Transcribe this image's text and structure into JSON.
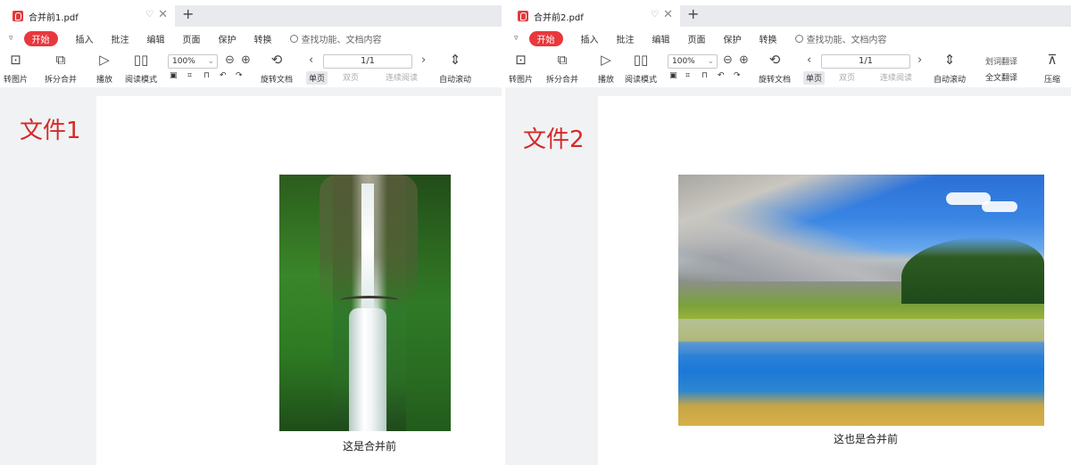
{
  "left_window": {
    "tab_title": "合并前1.pdf",
    "menu": [
      "开始",
      "插入",
      "批注",
      "编辑",
      "页面",
      "保护",
      "转换"
    ],
    "search_placeholder": "查找功能、文档内容",
    "toolbar": {
      "to_image": "转图片",
      "split_merge": "拆分合并",
      "play": "播放",
      "read_mode": "阅读模式",
      "zoom": "100%",
      "rotate_doc": "旋转文档",
      "page_indicator": "1/1",
      "single_page": "单页",
      "double_page": "双页",
      "continuous": "连续阅读",
      "auto_scroll": "自动滚动"
    },
    "side_label": "文件1",
    "caption": "这是合并前"
  },
  "right_window": {
    "tab_title": "合并前2.pdf",
    "menu": [
      "开始",
      "插入",
      "批注",
      "编辑",
      "页面",
      "保护",
      "转换"
    ],
    "search_placeholder": "查找功能、文档内容",
    "toolbar": {
      "to_image": "转图片",
      "split_merge": "拆分合并",
      "play": "播放",
      "read_mode": "阅读模式",
      "zoom": "100%",
      "rotate_doc": "旋转文档",
      "page_indicator": "1/1",
      "single_page": "单页",
      "double_page": "双页",
      "continuous": "连续阅读",
      "auto_scroll": "自动滚动",
      "word_translate": "划词翻译",
      "full_translate": "全文翻译",
      "compress": "压缩"
    },
    "side_label": "文件2",
    "caption": "这也是合并前"
  },
  "icons": {
    "pdf": "pdf-file-icon",
    "add_tab": "plus-icon",
    "close": "close-icon",
    "search": "search-icon"
  },
  "colors": {
    "accent": "#e8383d",
    "label_red": "#d42a2a"
  }
}
